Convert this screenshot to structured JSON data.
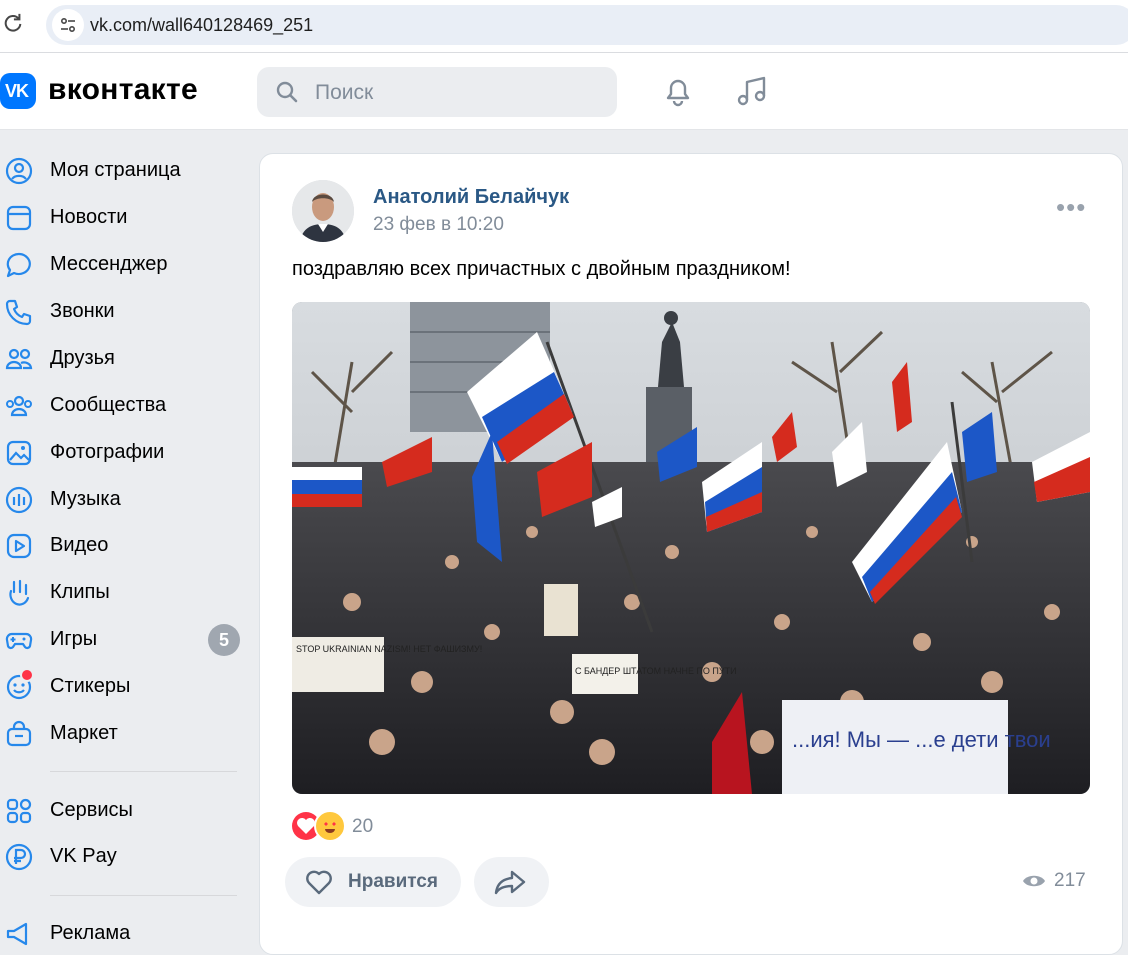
{
  "browser": {
    "url": "vk.com/wall640128469_251"
  },
  "header": {
    "logo_mark": "VK",
    "wordmark": "вконтакте",
    "search_placeholder": "Поиск"
  },
  "sidebar": {
    "items": [
      {
        "label": "Моя страница",
        "icon": "profile-icon"
      },
      {
        "label": "Новости",
        "icon": "news-icon"
      },
      {
        "label": "Мессенджер",
        "icon": "messenger-icon"
      },
      {
        "label": "Звонки",
        "icon": "phone-icon"
      },
      {
        "label": "Друзья",
        "icon": "friends-icon"
      },
      {
        "label": "Сообщества",
        "icon": "communities-icon"
      },
      {
        "label": "Фотографии",
        "icon": "photos-icon"
      },
      {
        "label": "Музыка",
        "icon": "music-icon"
      },
      {
        "label": "Видео",
        "icon": "video-icon"
      },
      {
        "label": "Клипы",
        "icon": "clips-icon"
      },
      {
        "label": "Игры",
        "icon": "games-icon",
        "badge": "5"
      },
      {
        "label": "Стикеры",
        "icon": "stickers-icon"
      },
      {
        "label": "Маркет",
        "icon": "market-icon"
      },
      {
        "label": "Сервисы",
        "icon": "services-icon"
      },
      {
        "label": "VK Pay",
        "icon": "vkpay-icon"
      },
      {
        "label": "Реклама",
        "icon": "ads-icon"
      }
    ]
  },
  "post": {
    "author": "Анатолий Белайчук",
    "date": "23 фев в 10:20",
    "text": "поздравляю всех причастных с двойным праздником!",
    "photo_signs": [
      "STOP UKRAINIAN NAZISM! НЕТ ФАШИЗМУ!",
      "С БАНДЕР ШТАТОМ НАЧНЕ ПО ПУТИ",
      "...ия! Мы — ...е дети твои"
    ],
    "reactions_count": "20",
    "like_label": "Нравится",
    "views": "217"
  },
  "colors": {
    "accent": "#0077ff",
    "author_link": "#2a5885",
    "secondary_text": "#818c99",
    "page_bg": "#ebedf0"
  }
}
